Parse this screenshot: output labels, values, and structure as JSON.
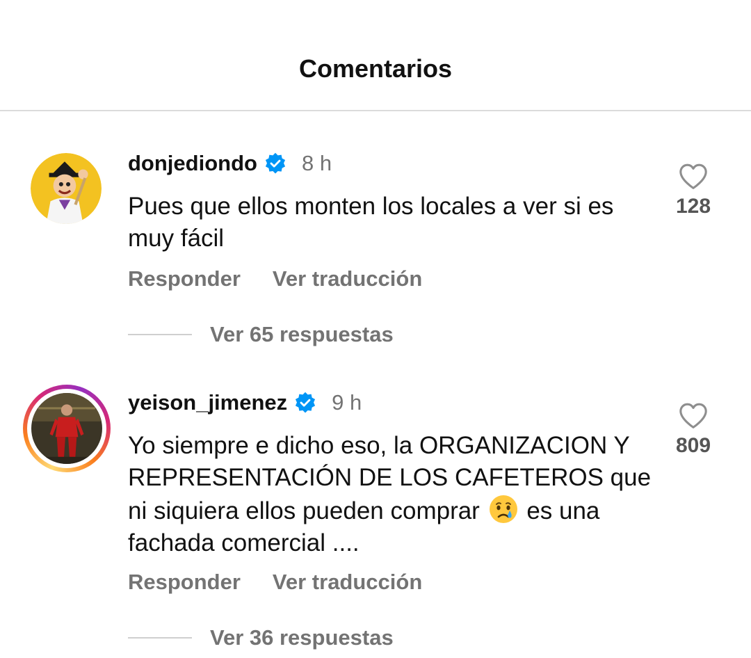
{
  "header": {
    "title": "Comentarios"
  },
  "comments": [
    {
      "username": "donjediondo",
      "time": "8 h",
      "text": "Pues que ellos monten los locales a ver si es muy fácil",
      "reply_label": "Responder",
      "translate_label": "Ver traducción",
      "likes": "128",
      "view_replies": "Ver 65 respuestas"
    },
    {
      "username": "yeison_jimenez",
      "time": "9 h",
      "text_part1": "Yo siempre e dicho eso, la ORGANIZACION Y REPRESENTACIÓN  DE LOS CAFETEROS que ni siquiera ellos pueden comprar",
      "text_part2": " es una fachada comercial ....",
      "reply_label": "Responder",
      "translate_label": "Ver traducción",
      "likes": "809",
      "view_replies": "Ver 36 respuestas"
    }
  ],
  "colors": {
    "verified": "#0095f6",
    "secondary_text": "#737373",
    "divider": "#dbdbdb"
  },
  "icons": [
    "verified-badge-icon",
    "heart-icon",
    "crying-face-emoji"
  ]
}
